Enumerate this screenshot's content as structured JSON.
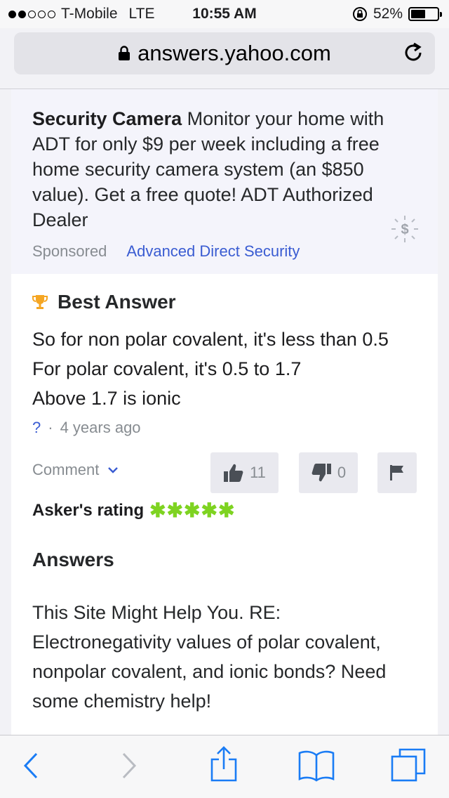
{
  "status": {
    "carrier": "T-Mobile",
    "network": "LTE",
    "time": "10:55 AM",
    "battery": "52%",
    "battery_level": 0.52,
    "signal_bars": 2
  },
  "browser": {
    "url": "answers.yahoo.com"
  },
  "ad": {
    "title_bold": "Security Camera",
    "body": " Monitor your home with ADT for only $9 per week including a free home security camera system (an $850 value). Get a free quote! ADT Authorized Dealer",
    "sponsored_label": "Sponsored",
    "advertiser": "Advanced Direct Security"
  },
  "best_answer": {
    "heading": "Best Answer",
    "lines": [
      "So for non polar covalent, it's less than 0.5",
      "For polar covalent, it's 0.5 to 1.7",
      "Above 1.7 is ionic"
    ],
    "author": "?",
    "separator": "·",
    "time_ago": "4 years ago",
    "comment_label": "Comment",
    "thumbs_up_count": "11",
    "thumbs_down_count": "0",
    "asker_rating_label": "Asker's rating",
    "stars": "✱✱✱✱✱",
    "star_rating": 5
  },
  "answers": {
    "heading": "Answers",
    "text": "This Site Might Help You. RE: Electronegativity values of polar covalent, nonpolar covalent, and ionic bonds? Need some chemistry help!"
  },
  "colors": {
    "link_blue": "#3a5cd2",
    "trophy": "#f5a623",
    "stars_green": "#7ed321",
    "ios_blue": "#1a7cf5"
  }
}
